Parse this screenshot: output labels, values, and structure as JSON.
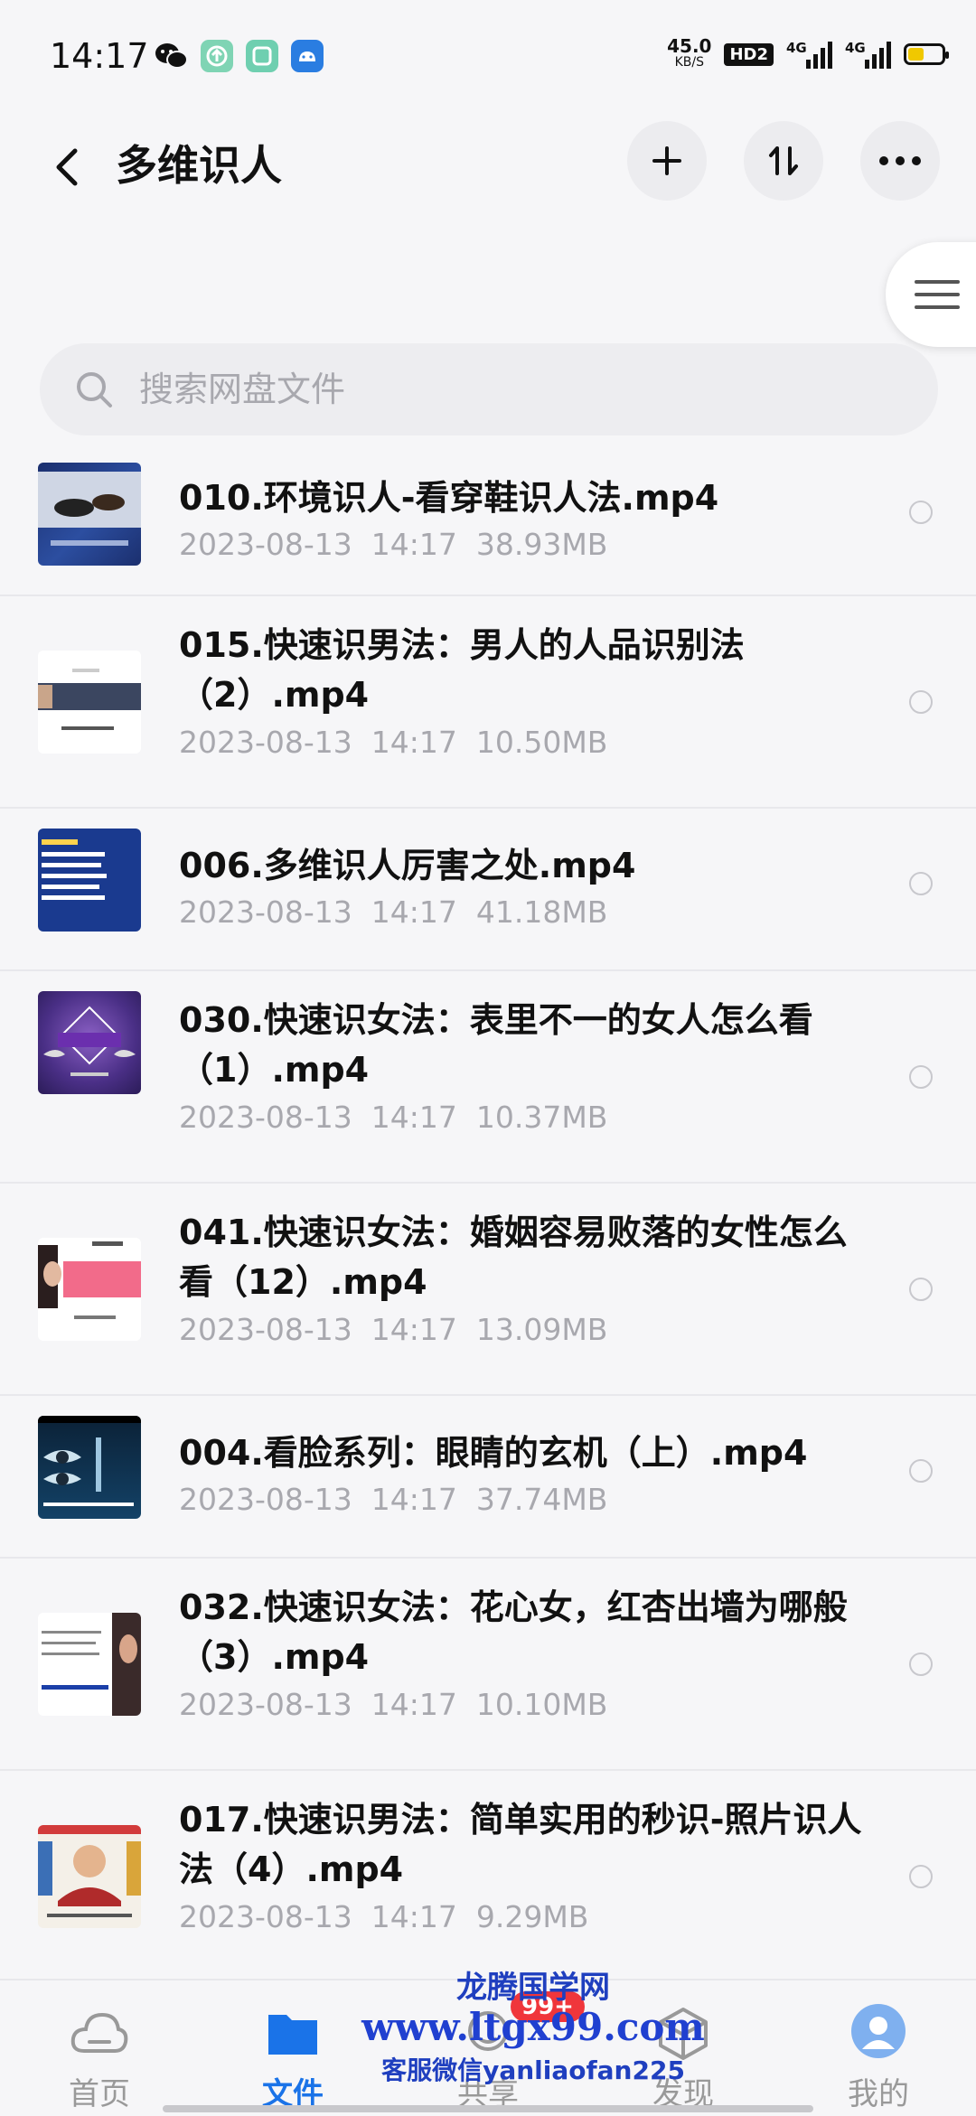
{
  "status_bar": {
    "time": "14:17",
    "net_speed_value": "45.0",
    "net_speed_unit": "KB/S",
    "hd_label": "HD2",
    "signal1_label": "4G",
    "signal2_label": "4G",
    "battery_level": 0.42
  },
  "header": {
    "back_icon": "chevron-left-icon",
    "title": "多维识人",
    "add_icon": "plus-icon",
    "sort_icon": "sort-arrows-icon",
    "more_icon": "more-horizontal-icon"
  },
  "search": {
    "placeholder": "搜索网盘文件"
  },
  "files": [
    {
      "name": "010.环境识人-看穿鞋识人法.mp4",
      "date": "2023-08-13",
      "time": "14:17",
      "size": "38.93MB"
    },
    {
      "name": "015.快速识男法：男人的人品识别法（2）.mp4",
      "date": "2023-08-13",
      "time": "14:17",
      "size": "10.50MB"
    },
    {
      "name": "006.多维识人厉害之处.mp4",
      "date": "2023-08-13",
      "time": "14:17",
      "size": "41.18MB"
    },
    {
      "name": "030.快速识女法：表里不一的女人怎么看（1）.mp4",
      "date": "2023-08-13",
      "time": "14:17",
      "size": "10.37MB"
    },
    {
      "name": "041.快速识女法：婚姻容易败落的女性怎么看（12）.mp4",
      "date": "2023-08-13",
      "time": "14:17",
      "size": "13.09MB"
    },
    {
      "name": "004.看脸系列：眼睛的玄机（上）.mp4",
      "date": "2023-08-13",
      "time": "14:17",
      "size": "37.74MB"
    },
    {
      "name": "032.快速识女法：花心女，红杏出墙为哪般（3）.mp4",
      "date": "2023-08-13",
      "time": "14:17",
      "size": "10.10MB"
    },
    {
      "name": "017.快速识男法：简单实用的秒识-照片识人法（4）.mp4",
      "date": "2023-08-13",
      "time": "14:17",
      "size": "9.29MB"
    }
  ],
  "bottom_nav": {
    "home": "首页",
    "files": "文件",
    "share": "共享",
    "share_badge": "99+",
    "discover": "发现",
    "me": "我的"
  },
  "watermark": {
    "line1": "龙腾国学网",
    "line2": "www.ltgx99.com",
    "line3": "客服微信yanliaofan225"
  },
  "colors": {
    "accent": "#1a73e8",
    "badge": "#f0363b",
    "background": "#f6f6f8"
  }
}
